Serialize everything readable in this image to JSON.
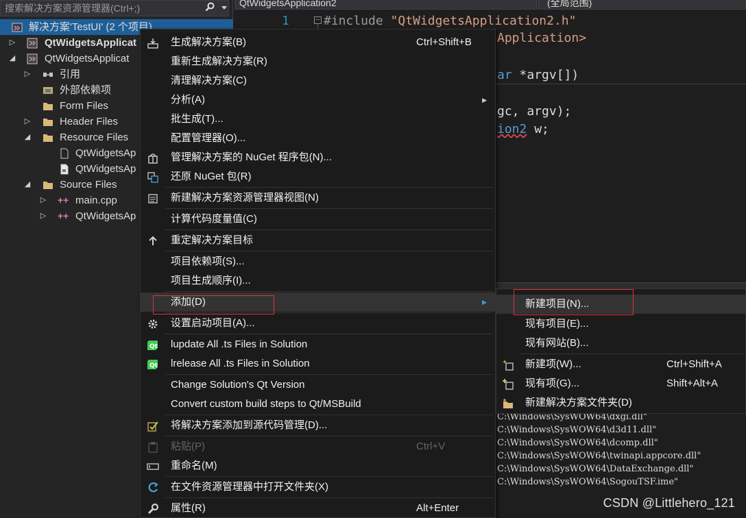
{
  "solution_explorer": {
    "search_placeholder": "搜索解决方案资源管理器(Ctrl+;)",
    "items": [
      {
        "label": "解决方案'TestUI' (2 个项目)",
        "icon": "solution-icon"
      },
      {
        "label": "QtWidgetsApplicat",
        "icon": "qt-project-icon"
      },
      {
        "label": "QtWidgetsApplicat",
        "icon": "qt-project-icon"
      },
      {
        "label": "引用",
        "icon": "references-icon"
      },
      {
        "label": "外部依赖项",
        "icon": "external-dependencies-icon"
      },
      {
        "label": "Form Files",
        "icon": "folder-icon"
      },
      {
        "label": "Header Files",
        "icon": "folder-icon"
      },
      {
        "label": "Resource Files",
        "icon": "folder-icon"
      },
      {
        "label": "QtWidgetsAp",
        "icon": "file-icon"
      },
      {
        "label": "QtWidgetsAp",
        "icon": "resource-file-icon"
      },
      {
        "label": "Source Files",
        "icon": "folder-icon"
      },
      {
        "label": "main.cpp",
        "icon": "cpp-file-icon"
      },
      {
        "label": "QtWidgetsAp",
        "icon": "cpp-file-icon"
      }
    ]
  },
  "editor": {
    "file_dropdown": "QtWidgetsApplication2",
    "scope_dropdown": "(全局范围)",
    "line_number": "1",
    "code": {
      "line1_directive": "#include ",
      "line1_string": "\"QtWidgetsApplication2.h\"",
      "line2_string": "Application>",
      "line3_kw": "ar",
      "line3_rest": " *argv[])",
      "line4": "gc, argv);",
      "line5_err": "ion2",
      "line5_rest": " w;"
    }
  },
  "output": {
    "lines": [
      "C:\\Windows\\SysWOW64\\dxgi.dll\"",
      "C:\\Windows\\SysWOW64\\d3d11.dll\"",
      "C:\\Windows\\SysWOW64\\dcomp.dll\"",
      "C:\\Windows\\SysWOW64\\twinapi.appcore.dll\"",
      "C:\\Windows\\SysWOW64\\DataExchange.dll\"",
      "C:\\Windows\\SysWOW64\\SogouTSF.ime\""
    ]
  },
  "context_menu": {
    "items": [
      {
        "label": "生成解决方案(B)",
        "shortcut": "Ctrl+Shift+B",
        "icon": "build-icon"
      },
      {
        "label": "重新生成解决方案(R)",
        "shortcut": ""
      },
      {
        "label": "清理解决方案(C)",
        "shortcut": ""
      },
      {
        "label": "分析(A)",
        "shortcut": "",
        "submenu": true
      },
      {
        "label": "批生成(T)...",
        "shortcut": ""
      },
      {
        "label": "配置管理器(O)...",
        "shortcut": ""
      },
      {
        "label": "管理解决方案的 NuGet 程序包(N)...",
        "shortcut": "",
        "icon": "nuget-icon"
      },
      {
        "label": "还原 NuGet 包(R)",
        "shortcut": "",
        "icon": "restore-icon"
      },
      {
        "label": "新建解决方案资源管理器视图(N)",
        "shortcut": "",
        "icon": "new-view-icon"
      },
      {
        "label": "计算代码度量值(C)",
        "shortcut": ""
      },
      {
        "label": "重定解决方案目标",
        "shortcut": "",
        "icon": "retarget-icon"
      },
      {
        "label": "项目依赖项(S)...",
        "shortcut": ""
      },
      {
        "label": "项目生成顺序(I)...",
        "shortcut": ""
      },
      {
        "label": "添加(D)",
        "shortcut": "",
        "submenu": true
      },
      {
        "label": "设置启动项目(A)...",
        "shortcut": "",
        "icon": "gear-icon"
      },
      {
        "label": "lupdate All .ts Files in Solution",
        "shortcut": "",
        "icon": "qt-icon"
      },
      {
        "label": "lrelease All .ts Files in Solution",
        "shortcut": "",
        "icon": "qt-icon"
      },
      {
        "label": "Change Solution's Qt Version",
        "shortcut": ""
      },
      {
        "label": "Convert custom build steps to Qt/MSBuild",
        "shortcut": ""
      },
      {
        "label": "将解决方案添加到源代码管理(D)...",
        "shortcut": "",
        "icon": "source-control-icon"
      },
      {
        "label": "粘贴(P)",
        "shortcut": "Ctrl+V",
        "icon": "paste-icon",
        "disabled": true
      },
      {
        "label": "重命名(M)",
        "shortcut": "",
        "icon": "rename-icon"
      },
      {
        "label": "在文件资源管理器中打开文件夹(X)",
        "shortcut": "",
        "icon": "open-folder-icon"
      },
      {
        "label": "属性(R)",
        "shortcut": "Alt+Enter",
        "icon": "wrench-icon"
      }
    ]
  },
  "submenu": {
    "items": [
      {
        "label": "新建项目(N)...",
        "shortcut": ""
      },
      {
        "label": "现有项目(E)...",
        "shortcut": ""
      },
      {
        "label": "现有网站(B)...",
        "shortcut": ""
      },
      {
        "label": "新建项(W)...",
        "shortcut": "Ctrl+Shift+A",
        "icon": "new-item-icon"
      },
      {
        "label": "现有项(G)...",
        "shortcut": "Shift+Alt+A",
        "icon": "existing-item-icon"
      },
      {
        "label": "新建解决方案文件夹(D)",
        "shortcut": "",
        "icon": "new-folder-icon"
      }
    ]
  },
  "watermark": "CSDN @Littlehero_121",
  "colors": {
    "highlight_box": "#e23131",
    "selection": "#1f5f99"
  }
}
